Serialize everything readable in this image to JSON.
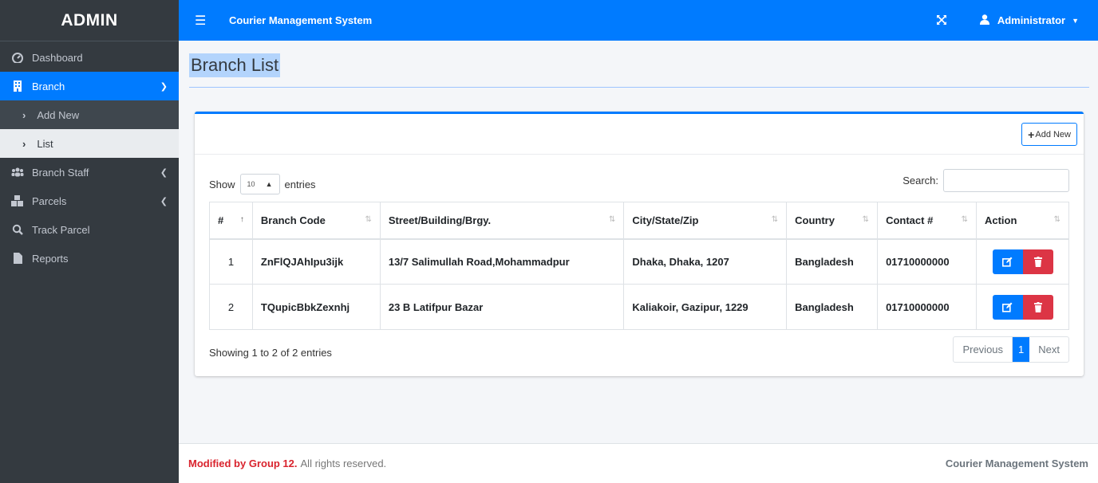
{
  "sidebar": {
    "brand": "ADMIN",
    "items": [
      {
        "label": "Dashboard",
        "icon": "dashboard-icon"
      },
      {
        "label": "Branch",
        "icon": "building-icon"
      },
      {
        "label": "Add New",
        "icon": "chevron-right-icon"
      },
      {
        "label": "List",
        "icon": "chevron-right-icon"
      },
      {
        "label": "Branch Staff",
        "icon": "users-icon"
      },
      {
        "label": "Parcels",
        "icon": "boxes-icon"
      },
      {
        "label": "Track Parcel",
        "icon": "search-icon"
      },
      {
        "label": "Reports",
        "icon": "file-icon"
      }
    ]
  },
  "topbar": {
    "title": "Courier Management System",
    "user": "Administrator"
  },
  "page": {
    "title": "Branch List"
  },
  "card": {
    "add_label": "Add New",
    "show_label": "Show",
    "entries_value": "10",
    "entries_label": "entries",
    "search_label": "Search:",
    "search_value": ""
  },
  "table": {
    "columns": [
      "#",
      "Branch Code",
      "Street/Building/Brgy.",
      "City/State/Zip",
      "Country",
      "Contact #",
      "Action"
    ],
    "rows": [
      {
        "num": "1",
        "code": "ZnFlQJAhIpu3ijk",
        "street": "13/7 Salimullah Road,Mohammadpur",
        "city": "Dhaka, Dhaka, 1207",
        "country": "Bangladesh",
        "contact": "01710000000"
      },
      {
        "num": "2",
        "code": "TQupicBbkZexnhj",
        "street": "23 B Latifpur Bazar",
        "city": "Kaliakoir, Gazipur, 1229",
        "country": "Bangladesh",
        "contact": "01710000000"
      }
    ]
  },
  "pagination": {
    "info": "Showing 1 to 2 of 2 entries",
    "previous": "Previous",
    "current": "1",
    "next": "Next"
  },
  "footer": {
    "modified": "Modified by Group 12.",
    "rights": "All rights reserved.",
    "app": "Courier Management System"
  },
  "colors": {
    "primary": "#007bff",
    "danger": "#dc3545",
    "sidebar": "#343a40"
  }
}
